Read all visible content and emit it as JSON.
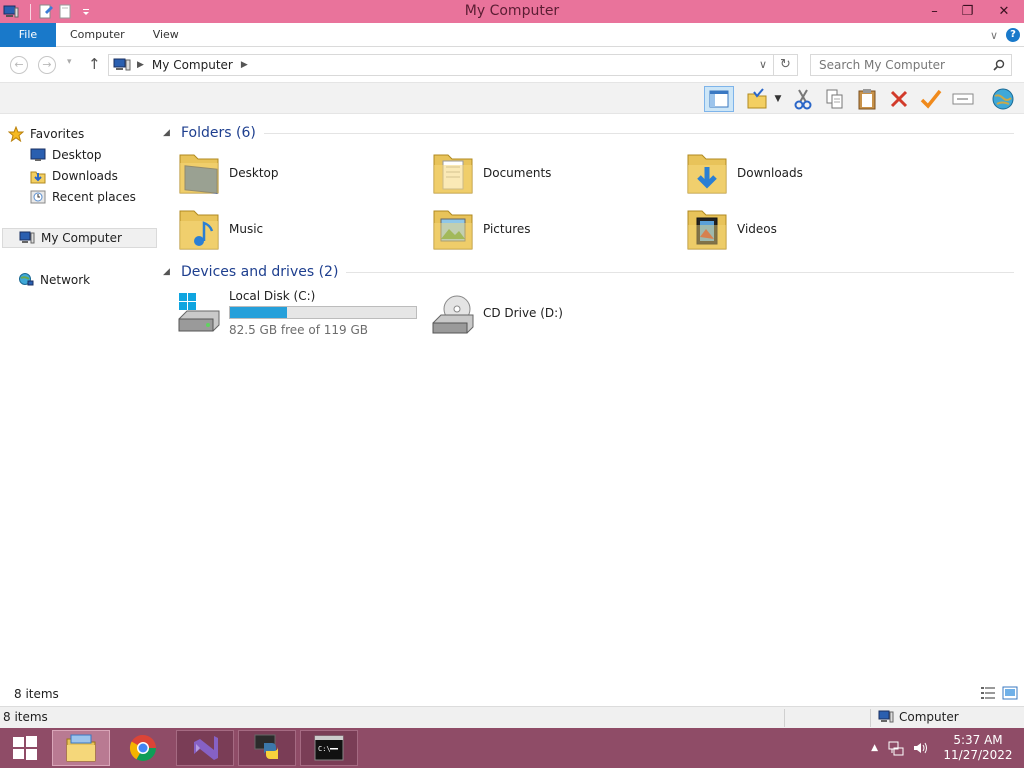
{
  "window": {
    "title": "My Computer",
    "controls": {
      "minimize": "–",
      "restore": "❐",
      "close": "✕"
    }
  },
  "ribbon": {
    "tabs": [
      "File",
      "Computer",
      "View"
    ],
    "expand_glyph": "∨",
    "help_glyph": "?"
  },
  "address": {
    "crumb": "My Computer",
    "search_placeholder": "Search My Computer"
  },
  "sidebar": {
    "favorites_label": "Favorites",
    "favorites": [
      {
        "label": "Desktop",
        "icon": "desktop-icon"
      },
      {
        "label": "Downloads",
        "icon": "downloads-icon"
      },
      {
        "label": "Recent places",
        "icon": "recent-places-icon"
      }
    ],
    "computer_label": "My Computer",
    "network_label": "Network"
  },
  "main": {
    "folders_header": "Folders (6)",
    "folders": [
      {
        "label": "Desktop",
        "icon": "desktop-folder-icon"
      },
      {
        "label": "Documents",
        "icon": "documents-folder-icon"
      },
      {
        "label": "Downloads",
        "icon": "downloads-folder-icon"
      },
      {
        "label": "Music",
        "icon": "music-folder-icon"
      },
      {
        "label": "Pictures",
        "icon": "pictures-folder-icon"
      },
      {
        "label": "Videos",
        "icon": "videos-folder-icon"
      }
    ],
    "devices_header": "Devices and drives (2)",
    "drives": [
      {
        "label": "Local Disk (C:)",
        "free_text": "82.5 GB free of 119 GB",
        "used_fraction": 0.307,
        "icon": "hard-disk-icon"
      },
      {
        "label": "CD Drive (D:)",
        "icon": "cd-drive-icon"
      }
    ]
  },
  "status": {
    "items_count": "8 items",
    "items_count_bottom": "8 items",
    "computer_label": "Computer"
  },
  "taskbar": {
    "time": "5:37 AM",
    "date": "11/27/2022",
    "color": "#8f4c67"
  },
  "colors": {
    "titlebar": "#e9739b",
    "file_tab": "#1979ca",
    "group_header": "#1e3f8f",
    "progress": "#26a0da"
  }
}
